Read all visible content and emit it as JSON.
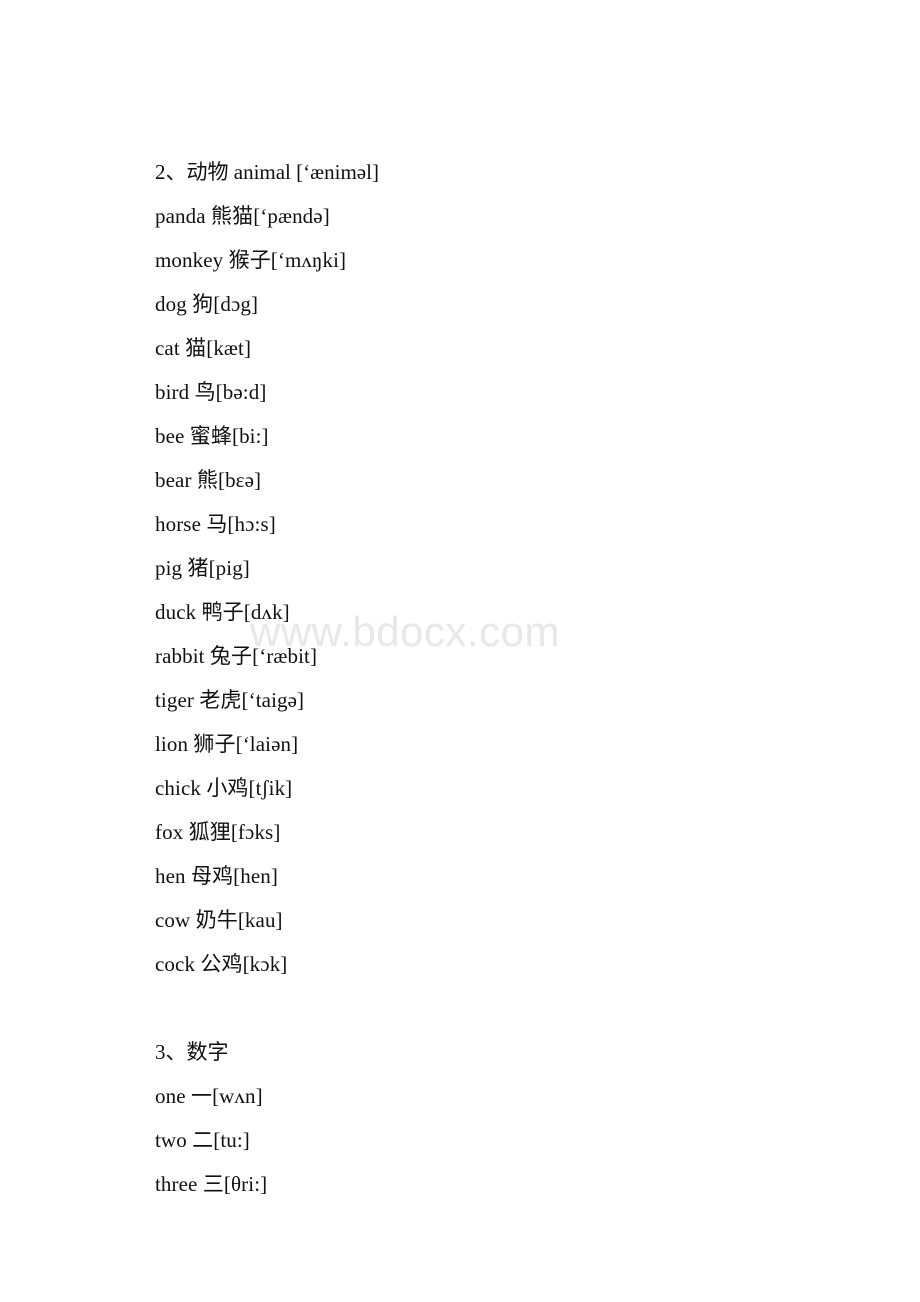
{
  "page": {
    "background_color": "#ffffff",
    "text_color": "#111111"
  },
  "watermark": {
    "text": "www.bdocx.com",
    "color": "#e8e8e8"
  },
  "sections": [
    {
      "heading": "2、动物 animal [‘æniməl]",
      "entries": [
        "panda 熊猫[‘pændə]",
        "monkey 猴子[‘mʌŋki]",
        "dog 狗[dɔg]",
        "cat 猫[kæt]",
        "bird 鸟[bə:d]",
        "bee 蜜蜂[bi:]",
        "bear 熊[bɛə]",
        "horse 马[hɔ:s]",
        "pig 猪[pig]",
        "duck 鸭子[dʌk]",
        "rabbit 兔子[‘ræbit]",
        "tiger 老虎[‘taigə]",
        "lion 狮子[‘laiən]",
        "chick 小鸡[tʃik]",
        "fox 狐狸[fɔks]",
        "hen 母鸡[hen]",
        "cow 奶牛[kau]",
        "cock 公鸡[kɔk]"
      ]
    },
    {
      "heading": "3、数字",
      "entries": [
        "one 一[wʌn]",
        "two 二[tu:]",
        "three 三[θri:]"
      ]
    }
  ]
}
